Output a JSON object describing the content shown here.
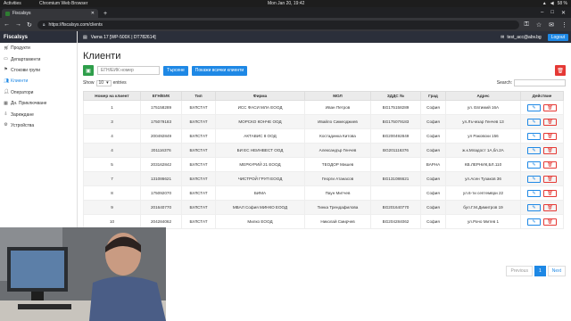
{
  "os_bar": {
    "activities": "Activities",
    "app": "Chromium Web Browser",
    "clock": "Mon Jan 20, 19:42",
    "battery": "58 %"
  },
  "browser": {
    "tab_title": "Fiscalsys",
    "url": "https://fiscalsys.com/clients"
  },
  "app": {
    "brand": "Fiscalsys",
    "device": "Varna 17 [WP-500X | DT782614]",
    "user": "test_acc@abv.bg",
    "logout": "Logout",
    "nav": [
      {
        "label": "Продукти",
        "icon": "cart"
      },
      {
        "label": "Департаменти",
        "icon": "folder"
      },
      {
        "label": "Стокови групи",
        "icon": "tags"
      },
      {
        "label": "Клиенти",
        "icon": "users"
      },
      {
        "label": "Оператори",
        "icon": "user"
      },
      {
        "label": "Дн. Приключване",
        "icon": "report"
      },
      {
        "label": "Зареждане",
        "icon": "download"
      },
      {
        "label": "Устройства",
        "icon": "gear"
      }
    ],
    "page_title": "Клиенти",
    "search_placeholder": "ЕГН/ЕИК номер",
    "search_button": "Търсене",
    "show_all_button": "Покажи всички клиенти",
    "show_label": "Show",
    "entries_value": "10",
    "entries_label": "entries",
    "search_label": "Search:",
    "columns": [
      "Номер на клиент",
      "ЕГН/ЕИК",
      "Тип",
      "Фирма",
      "МОЛ",
      "ЗДДС №",
      "Град",
      "Адрес",
      "Действие"
    ],
    "rows": [
      [
        "1",
        "175158289",
        "БУЛСТАТ",
        "ИСС ФАСИ МЛА ЕООД",
        "Иван Петров",
        "BG175158289",
        "София",
        "ул. Евтимий 16А"
      ],
      [
        "3",
        "175079183",
        "БУЛСТАТ",
        "МОРСКО КОНЧЕ ООД",
        "Ивайло Симеоджиев",
        "BG175079183",
        "София",
        "ул.Лъчезар Генчев 13"
      ],
      [
        "4",
        "200492849",
        "БУЛСТАТ",
        "АКТАВИС 8 ООД",
        "Костадинка Китова",
        "BG200492849",
        "София",
        "ул Раковски 156"
      ],
      [
        "4",
        "201116376",
        "БУЛСТАТ",
        "БИ ЕС НЕИНВЕСТ ООД",
        "Александър Генчев",
        "BG201116376",
        "София",
        "ж.к.Младост 1А,бл.2А"
      ],
      [
        "5",
        "203162842",
        "БУЛСТАТ",
        "МЕРКУРИЙ 21 ЕООД",
        "ТЕОДОР Мишев",
        "",
        "ВАРНА",
        "КВ.ЛЕРНИК,БЛ.110"
      ],
      [
        "7",
        "131086621",
        "БУЛСТАТ",
        "ЧИСТРОЙ ГРУП ЕООД",
        "Георги Атанасов",
        "BG131086621",
        "София",
        "ул.Асен Тузаков 36"
      ],
      [
        "8",
        "175092070",
        "БУЛСТАТ",
        "БИМА",
        "Паун Митчев",
        "",
        "София",
        "ул.6-ти септември 22"
      ],
      [
        "9",
        "201640770",
        "БУЛСТАТ",
        "МВАЛ София МИНКО ЕООД",
        "Тинка Трендафилова",
        "BG201640770",
        "София",
        "бул.Г.М.Димитров 19"
      ],
      [
        "10",
        "204284062",
        "БУЛСТАТ",
        "Милко ЕООД",
        "Николай Смирчев",
        "BG204284062",
        "София",
        "ул.Рачо Митев 1"
      ]
    ],
    "pager": {
      "prev": "Previous",
      "current": "1",
      "next": "Next"
    }
  },
  "colors": {
    "accent": "#1e88e5",
    "success": "#2e9e4a",
    "danger": "#e53935",
    "header_dark": "#2b2f3a"
  }
}
